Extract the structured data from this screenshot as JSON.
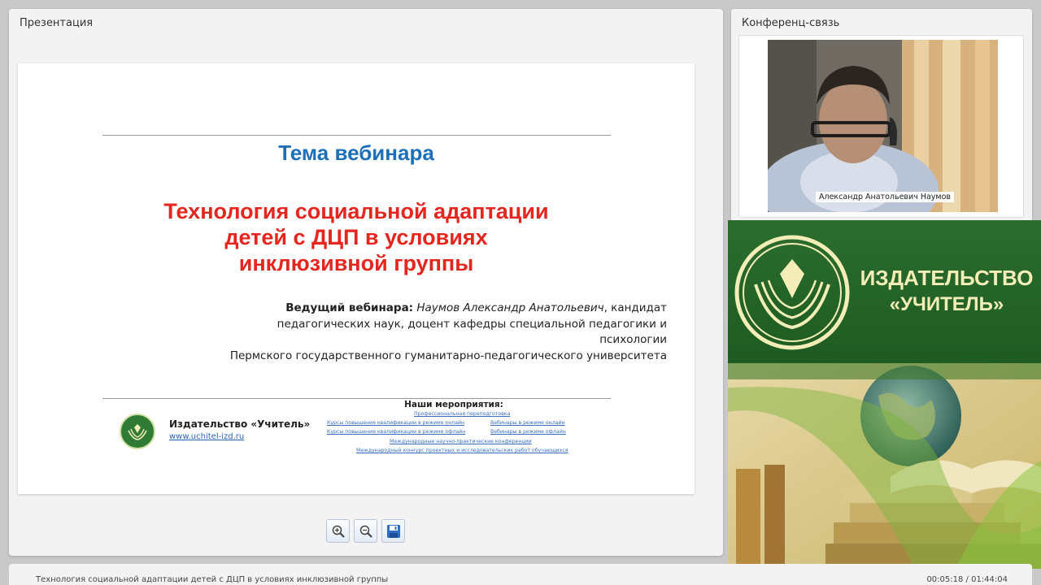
{
  "presentation": {
    "panel_title": "Презентация",
    "slide": {
      "heading": "Тема вебинара",
      "title_lines": [
        "Технология социальной адаптации",
        "детей с ДЦП в условиях",
        "инклюзивной группы"
      ],
      "host_label": "Ведущий вебинара:",
      "host_name": "Наумов Александр Анатольевич",
      "host_line1_rest": ", кандидат",
      "host_line2": "педагогических наук, доцент кафедры специальной педагогики и психологии",
      "host_line3": "Пермского государственного гуманитарно-педагогического университета",
      "publisher_name": "Издательство «Учитель»",
      "publisher_url": "www.uchitel-izd.ru",
      "events_title": "Наши мероприятия:",
      "events": [
        "Профессиональная переподготовка",
        "Курсы повышения квалификации в режиме онлайн",
        "Вебинары в режиме онлайн",
        "Курсы повышения квалификации в режиме офлайн",
        "Вебинары в режиме офлайн",
        "Международные научно-практические конференции",
        "Международный конкурс проектных и исследовательских работ обучающихся"
      ]
    },
    "toolbar": {
      "zoom_in": "zoom-in-icon",
      "zoom_out": "zoom-out-icon",
      "save": "save-icon"
    }
  },
  "conference": {
    "panel_title": "Конференц-связь",
    "participant_name": "Александр Анатольевич Наумов"
  },
  "ad": {
    "brand_line1": "ИЗДАТЕЛЬСТВО",
    "brand_line2": "«УЧИТЕЛЬ»"
  },
  "footer": {
    "title": "Технология социальной адаптации детей с ДЦП в условиях инклюзивной группы",
    "time": "00:05:18 / 01:44:04"
  },
  "colors": {
    "heading_blue": "#1d70b8",
    "title_red": "#e5261f",
    "brand_green": "#2c6d2f",
    "brand_text": "#f3eeb8"
  }
}
